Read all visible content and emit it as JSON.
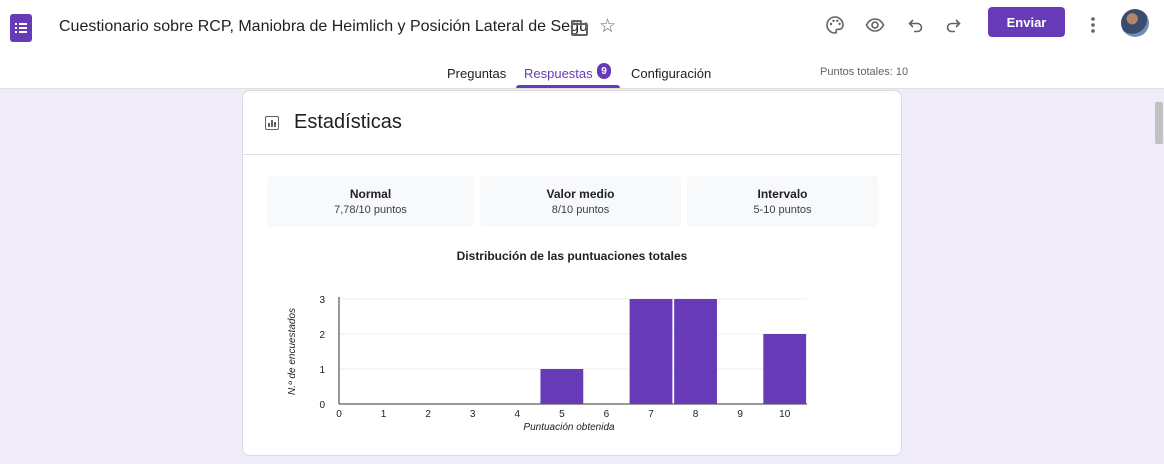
{
  "app": {
    "title": "Cuestionario sobre RCP, Maniobra de Heimlich y Posición Lateral de Segu",
    "send_label": "Enviar",
    "accent": "#673ab7",
    "icons": [
      "palette-icon",
      "eye-icon",
      "undo-icon",
      "redo-icon",
      "more-vert-icon"
    ]
  },
  "tabs": [
    {
      "label": "Preguntas",
      "active": false
    },
    {
      "label": "Respuestas",
      "active": true,
      "badge": "9"
    },
    {
      "label": "Configuración",
      "active": false
    }
  ],
  "total_points": "Puntos totales: 10",
  "stats": {
    "heading": "Estadísticas",
    "items": [
      {
        "label": "Normal",
        "value": "7,78/10 puntos"
      },
      {
        "label": "Valor medio",
        "value": "8/10 puntos"
      },
      {
        "label": "Intervalo",
        "value": "5-10 puntos"
      }
    ]
  },
  "chart_data": {
    "type": "bar",
    "title": "Distribución de las puntuaciones totales",
    "xlabel": "Puntuación obtenida",
    "ylabel": "N.º de encuestados",
    "categories": [
      "0",
      "1",
      "2",
      "3",
      "4",
      "5",
      "6",
      "7",
      "8",
      "9",
      "10"
    ],
    "values": [
      0,
      0,
      0,
      0,
      0,
      1,
      0,
      3,
      3,
      0,
      2
    ],
    "yticks": [
      "0",
      "1",
      "2",
      "3"
    ],
    "ylim": [
      0,
      3
    ],
    "grid": true,
    "bar_color": "#673ab7"
  }
}
